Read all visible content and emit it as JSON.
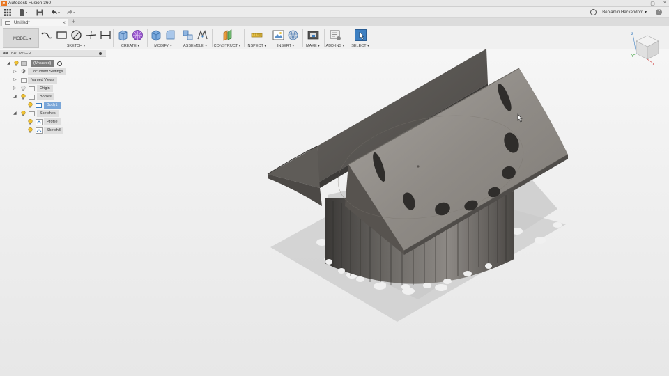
{
  "app": {
    "title": "Autodesk Fusion 360",
    "user": "Benjamin Heckendorn"
  },
  "document": {
    "tab_label": "Untitled*"
  },
  "workspace": {
    "label": "MODEL ▾"
  },
  "toolbar": {
    "groups": [
      {
        "label": "SKETCH ▾"
      },
      {
        "label": "CREATE ▾"
      },
      {
        "label": "MODIFY ▾"
      },
      {
        "label": "ASSEMBLE ▾"
      },
      {
        "label": "CONSTRUCT ▾"
      },
      {
        "label": "INSPECT ▾"
      },
      {
        "label": "INSERT ▾"
      },
      {
        "label": "MAKE ▾"
      },
      {
        "label": "ADD-INS ▾"
      },
      {
        "label": "SELECT ▾"
      }
    ]
  },
  "browser": {
    "title": "BROWSER",
    "items": [
      {
        "label": "(Unsaved)"
      },
      {
        "label": "Document Settings"
      },
      {
        "label": "Named Views"
      },
      {
        "label": "Origin"
      },
      {
        "label": "Bodies"
      },
      {
        "label": "Body1"
      },
      {
        "label": "Sketches"
      },
      {
        "label": "Profile"
      },
      {
        "label": "Sketch3"
      }
    ]
  },
  "viewcube": {
    "axes": [
      "Z",
      "Y",
      "X"
    ]
  },
  "colors": {
    "accent": "#3d7fc1",
    "selected_row": "#7aa6d8",
    "model_surface": "#8f8b86",
    "model_dark": "#55524e",
    "toolbar_bg": "#f0f0f0"
  }
}
